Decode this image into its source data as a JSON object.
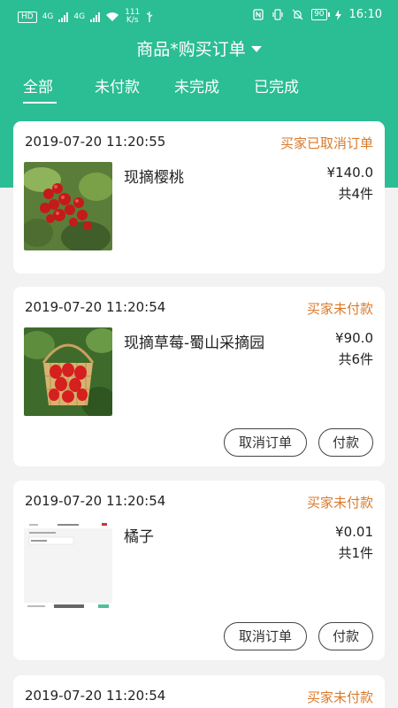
{
  "status_bar": {
    "left_text": [
      "HD",
      "4G",
      "4G"
    ],
    "net_speed": "111",
    "net_unit": "K/s",
    "battery": "90",
    "time": "16:10",
    "icons": [
      "nfc-icon",
      "vibrate-icon",
      "mute-icon",
      "battery-icon"
    ]
  },
  "header": {
    "title": "商品*购买订单"
  },
  "tabs": [
    {
      "label": "全部",
      "active": true
    },
    {
      "label": "未付款",
      "active": false
    },
    {
      "label": "未完成",
      "active": false
    },
    {
      "label": "已完成",
      "active": false
    }
  ],
  "orders": [
    {
      "time": "2019-07-20 11:20:55",
      "status": "买家已取消订单",
      "product": "现摘樱桃",
      "price": "¥140.0",
      "qty": "共4件",
      "thumb": "cherry",
      "buttons": []
    },
    {
      "time": "2019-07-20 11:20:54",
      "status": "买家未付款",
      "product": "现摘草莓-蜀山采摘园",
      "price": "¥90.0",
      "qty": "共6件",
      "thumb": "strawberry",
      "buttons": [
        "取消订单",
        "付款"
      ]
    },
    {
      "time": "2019-07-20 11:20:54",
      "status": "买家未付款",
      "product": "橘子",
      "price": "¥0.01",
      "qty": "共1件",
      "thumb": "screenshot",
      "buttons": [
        "取消订单",
        "付款"
      ]
    },
    {
      "time": "2019-07-20 11:20:54",
      "status": "买家未付款"
    }
  ],
  "colors": {
    "header": "#2bbd93",
    "status_text": "#d97a2b",
    "background": "#f2f2f2"
  }
}
